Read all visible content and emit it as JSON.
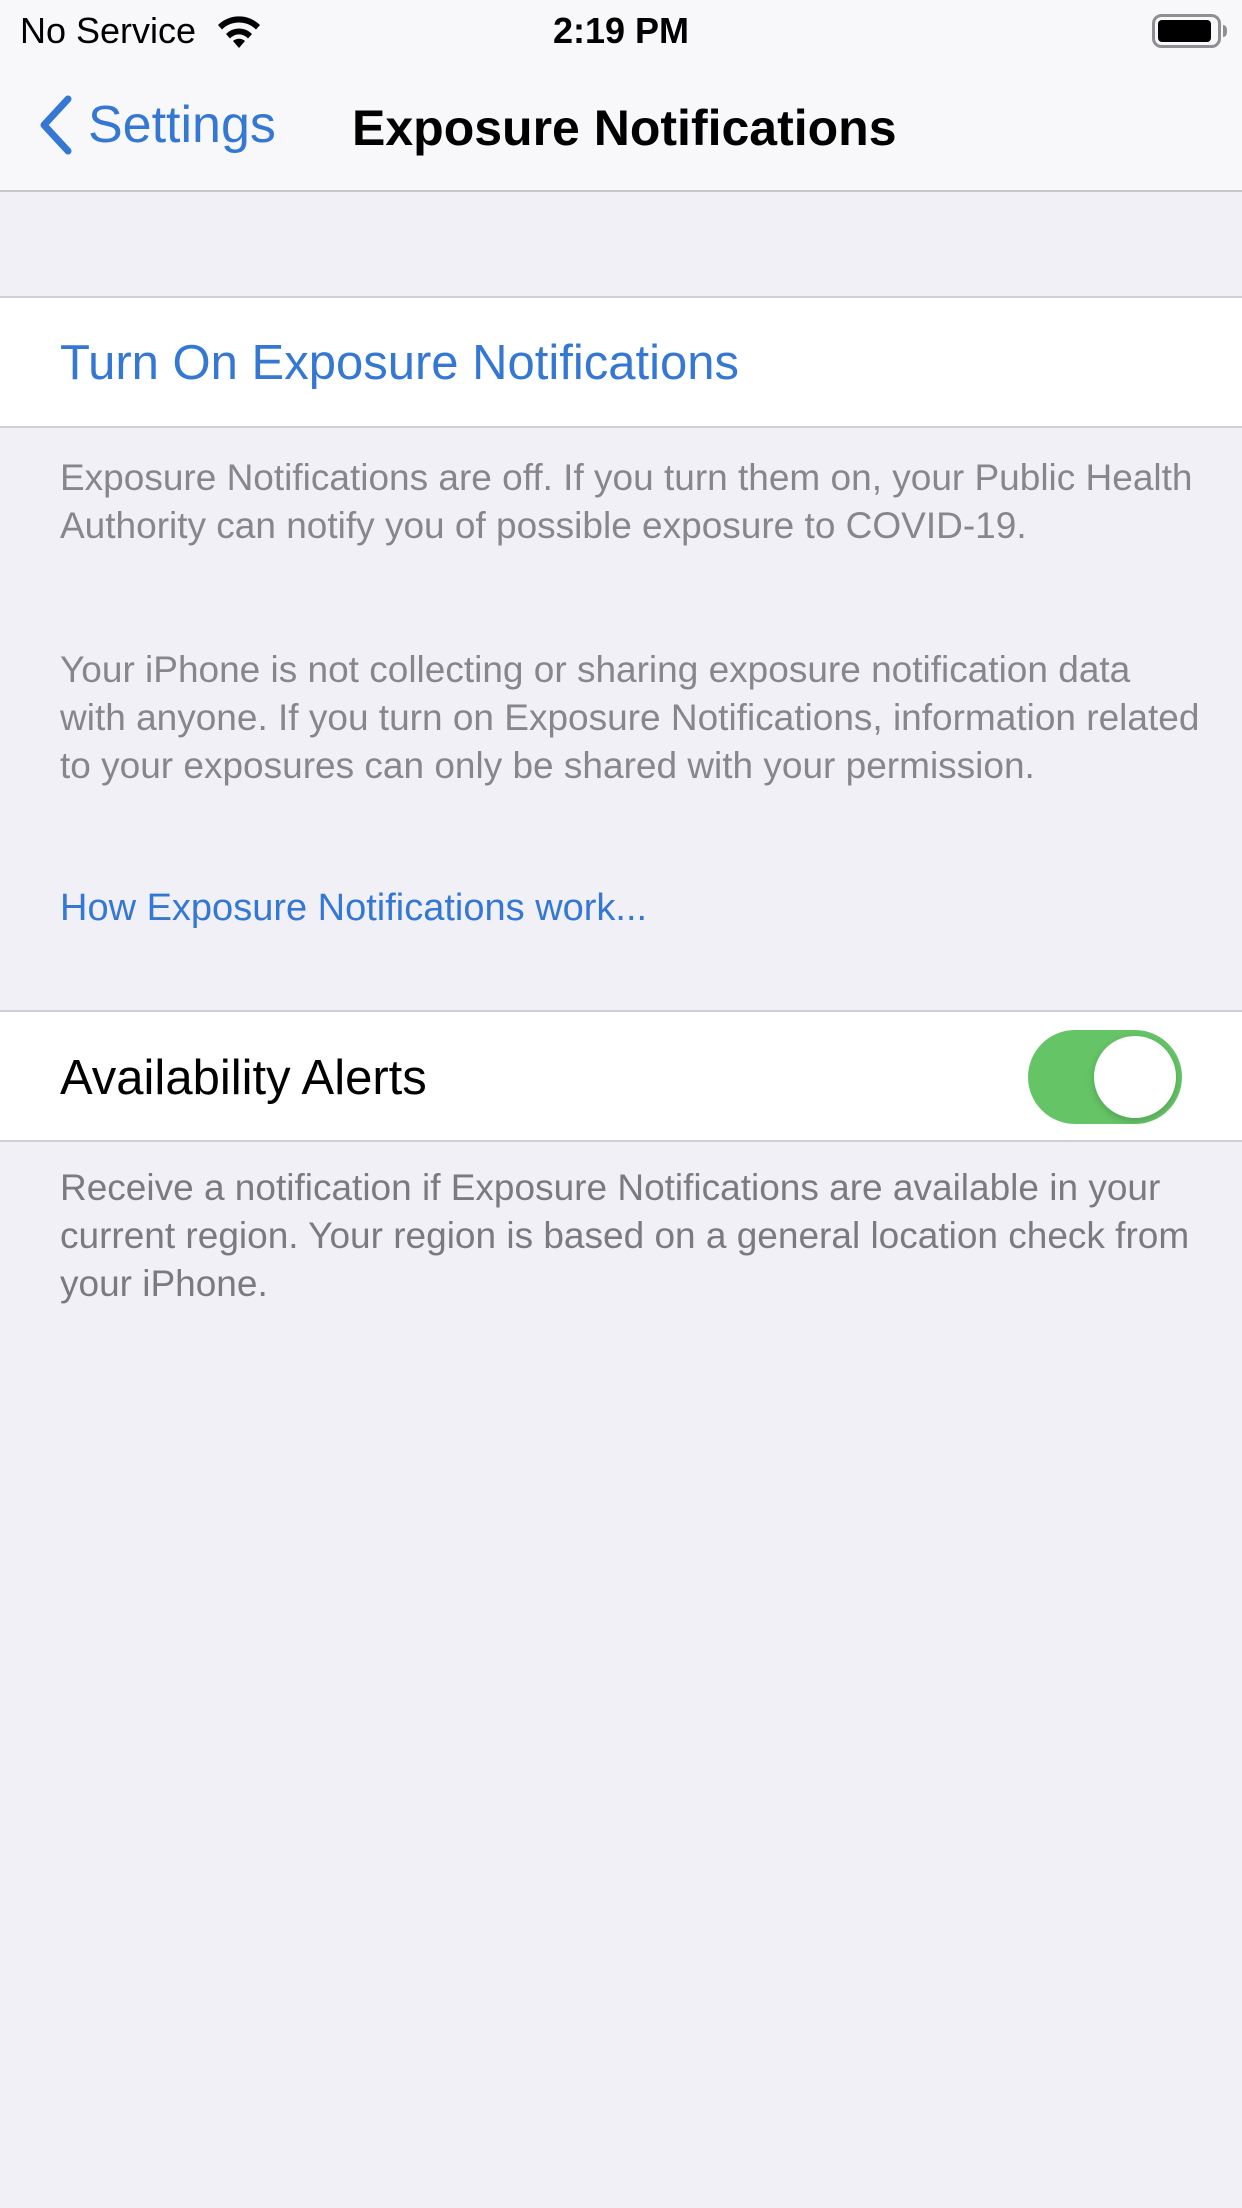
{
  "status_bar": {
    "carrier": "No Service",
    "time": "2:19 PM",
    "wifi_icon": "wifi-icon",
    "battery_icon": "battery-icon"
  },
  "nav": {
    "back_label": "Settings",
    "back_icon": "chevron-left-icon",
    "title": "Exposure Notifications"
  },
  "main": {
    "turn_on_label": "Turn On Exposure Notifications",
    "paragraph_1": "Exposure Notifications are off. If you turn them on, your Public Health Authority can notify you of possible exposure to COVID-19.",
    "paragraph_2": "Your iPhone is not collecting or sharing exposure notification data with anyone. If you turn on Exposure Notifications, information related to your exposures can only be shared with your permission.",
    "how_link": "How Exposure Notifications work...",
    "availability_alerts": {
      "label": "Availability Alerts",
      "toggle_on": true
    },
    "paragraph_3": "Receive a notification if Exposure Notifications are available in your current region. Your region is based on a general location check from your iPhone."
  },
  "colors": {
    "accent": "#3478d4",
    "toggle_on": "#65c466",
    "background": "#f0f0f6",
    "secondary_text": "#86868c"
  }
}
